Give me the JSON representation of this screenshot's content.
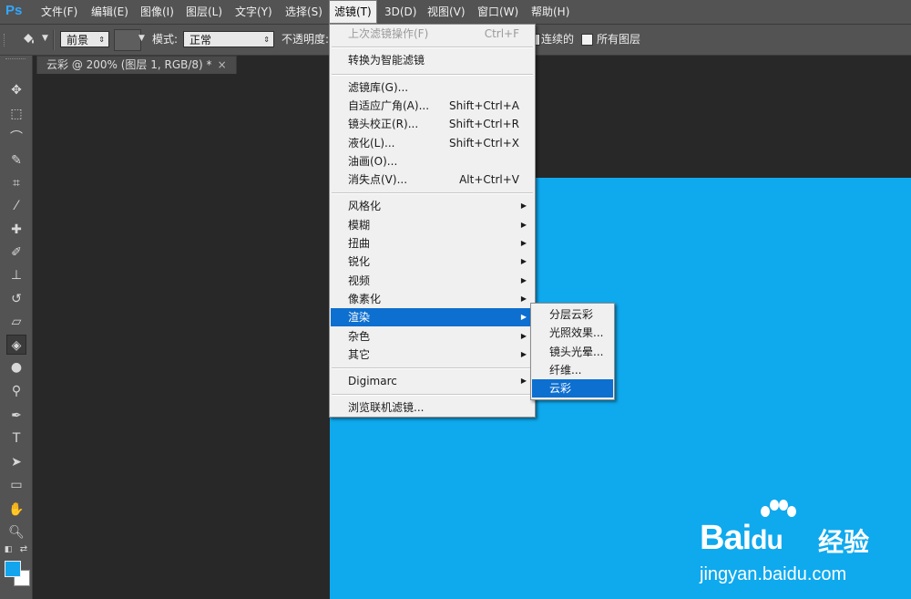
{
  "app": {
    "logo": "Ps"
  },
  "menubar": [
    {
      "label": "文件(F)",
      "active": false
    },
    {
      "label": "编辑(E)",
      "active": false
    },
    {
      "label": "图像(I)",
      "active": false
    },
    {
      "label": "图层(L)",
      "active": false
    },
    {
      "label": "文字(Y)",
      "active": false
    },
    {
      "label": "选择(S)",
      "active": false
    },
    {
      "label": "滤镜(T)",
      "active": true
    },
    {
      "label": "3D(D)",
      "active": false
    },
    {
      "label": "视图(V)",
      "active": false
    },
    {
      "label": "窗口(W)",
      "active": false
    },
    {
      "label": "帮助(H)",
      "active": false
    }
  ],
  "options": {
    "tool_icon": "paint-bucket-icon",
    "fill_source": "前景",
    "mode_label": "模式:",
    "mode_value": "正常",
    "opacity_label": "不透明度:",
    "contiguous_label": "连续的",
    "all_layers_label": "所有图层"
  },
  "document": {
    "tab_title": "云彩 @ 200% (图层 1, RGB/8) *",
    "close_glyph": "×",
    "canvas_color": "#0fa9ee"
  },
  "colors": {
    "foreground": "#12a5ee",
    "background": "#ffffff",
    "accent": "#0d6fcf"
  },
  "filter_menu": {
    "items": [
      {
        "label": "上次滤镜操作(F)",
        "shortcut": "Ctrl+F",
        "disabled": true
      },
      {
        "sep": true
      },
      {
        "label": "转换为智能滤镜"
      },
      {
        "sep": true
      },
      {
        "label": "滤镜库(G)..."
      },
      {
        "label": "自适应广角(A)...",
        "shortcut": "Shift+Ctrl+A"
      },
      {
        "label": "镜头校正(R)...",
        "shortcut": "Shift+Ctrl+R"
      },
      {
        "label": "液化(L)...",
        "shortcut": "Shift+Ctrl+X"
      },
      {
        "label": "油画(O)..."
      },
      {
        "label": "消失点(V)...",
        "shortcut": "Alt+Ctrl+V"
      },
      {
        "sep": true
      },
      {
        "label": "风格化",
        "submenu": true
      },
      {
        "label": "模糊",
        "submenu": true
      },
      {
        "label": "扭曲",
        "submenu": true
      },
      {
        "label": "锐化",
        "submenu": true
      },
      {
        "label": "视频",
        "submenu": true
      },
      {
        "label": "像素化",
        "submenu": true
      },
      {
        "label": "渲染",
        "submenu": true,
        "highlight": true
      },
      {
        "label": "杂色",
        "submenu": true
      },
      {
        "label": "其它",
        "submenu": true
      },
      {
        "sep": true
      },
      {
        "label": "Digimarc",
        "submenu": true
      },
      {
        "sep": true
      },
      {
        "label": "浏览联机滤镜..."
      }
    ]
  },
  "render_submenu": {
    "items": [
      {
        "label": "分层云彩"
      },
      {
        "label": "光照效果..."
      },
      {
        "label": "镜头光晕..."
      },
      {
        "label": "纤维..."
      },
      {
        "label": "云彩",
        "highlight": true
      }
    ]
  },
  "watermark": {
    "brand": "Bai",
    "brand2": "du",
    "suffix": "经验",
    "url": "jingyan.baidu.com"
  }
}
